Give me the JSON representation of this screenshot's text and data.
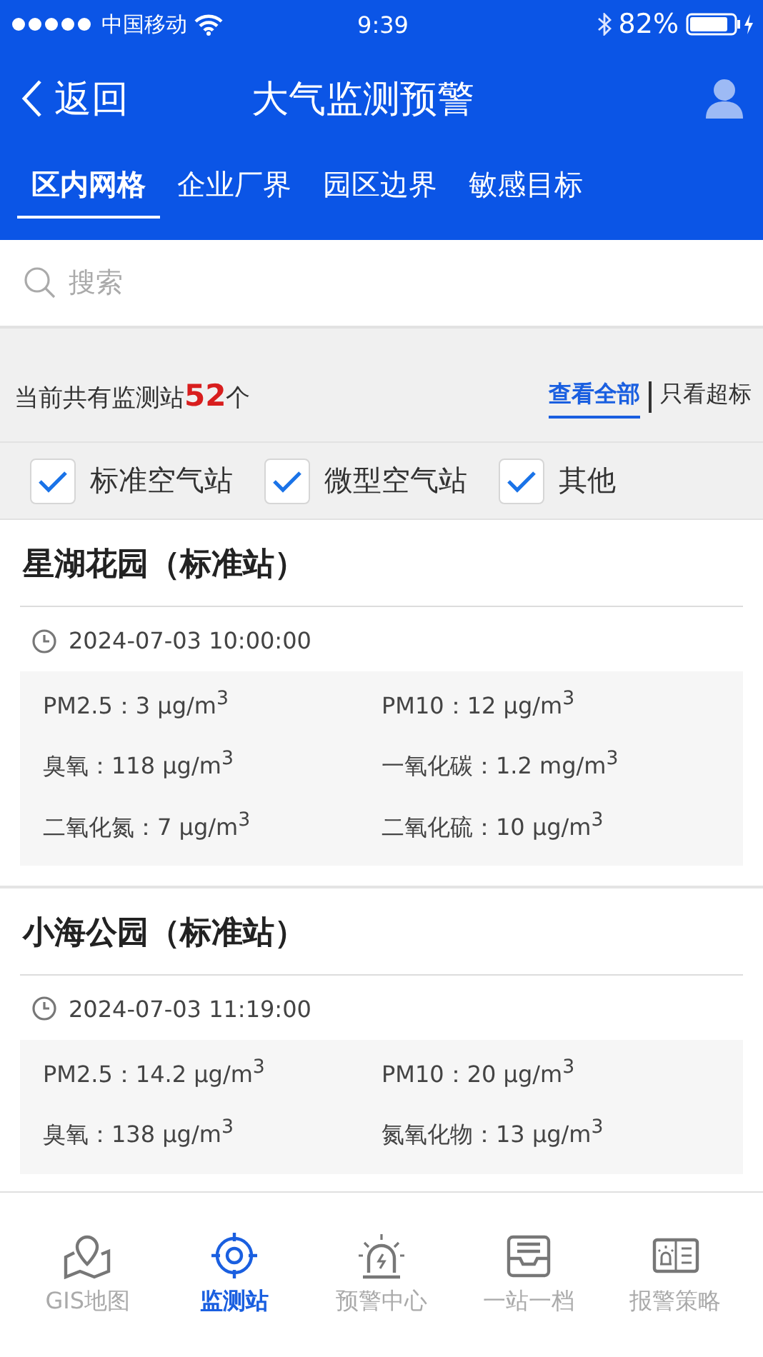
{
  "status_bar": {
    "carrier": "中国移动",
    "time": "9:39",
    "battery": "82%"
  },
  "nav": {
    "back": "返回",
    "title": "大气监测预警"
  },
  "tabs": [
    {
      "label": "区内网格",
      "selected": true
    },
    {
      "label": "企业厂界",
      "selected": false
    },
    {
      "label": "园区边界",
      "selected": false
    },
    {
      "label": "敏感目标",
      "selected": false
    }
  ],
  "search": {
    "placeholder": "搜索"
  },
  "summary": {
    "prefix": "当前共有监测站",
    "count": "52",
    "suffix": "个"
  },
  "view_filters": [
    {
      "label": "查看全部",
      "selected": true
    },
    {
      "label": "只看超标",
      "selected": false
    }
  ],
  "type_filters": [
    {
      "label": "标准空气站",
      "checked": true
    },
    {
      "label": "微型空气站",
      "checked": true
    },
    {
      "label": "其他",
      "checked": true
    }
  ],
  "stations": [
    {
      "name": "星湖花园（标准站）",
      "time": "2024-07-03 10:00:00",
      "readings": [
        "PM2.5：3 μg/m$^{3}$",
        "PM10：12 μg/m$^{3}$",
        "臭氧：118 μg/m$^{3}$",
        "一氧化碳：1.2 mg/m$^{3}$",
        "二氧化氮：7 μg/m$^{3}$",
        "二氧化硫：10 μg/m$^{3}$"
      ]
    },
    {
      "name": "小海公园（标准站）",
      "time": "2024-07-03 11:19:00",
      "readings": [
        "PM2.5：14.2 μg/m$^{3}$",
        "PM10：20 μg/m$^{3}$",
        "臭氧：138 μg/m$^{3}$",
        "氮氧化物：13 μg/m$^{3}$"
      ]
    }
  ],
  "bottom_nav": [
    {
      "label": "GIS地图",
      "kind": "map",
      "selected": false
    },
    {
      "label": "监测站",
      "kind": "target",
      "selected": true
    },
    {
      "label": "预警中心",
      "kind": "alarm",
      "selected": false
    },
    {
      "label": "一站一档",
      "kind": "inbox",
      "selected": false
    },
    {
      "label": "报警策略",
      "kind": "board",
      "selected": false
    }
  ]
}
